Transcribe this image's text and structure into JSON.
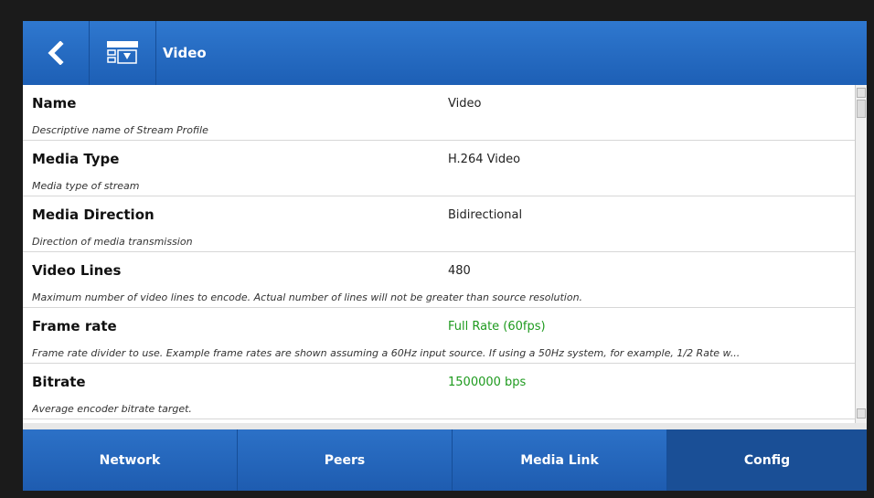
{
  "header": {
    "title": "Video",
    "back_icon": "chevron-left-icon",
    "profile_icon": "stream-profile-icon"
  },
  "rows": [
    {
      "label": "Name",
      "value": "Video",
      "desc": "Descriptive name of Stream Profile",
      "value_color": "default"
    },
    {
      "label": "Media Type",
      "value": "H.264 Video",
      "desc": "Media type of stream",
      "value_color": "default"
    },
    {
      "label": "Media Direction",
      "value": "Bidirectional",
      "desc": "Direction of media transmission",
      "value_color": "default"
    },
    {
      "label": "Video Lines",
      "value": "480",
      "desc": "Maximum number of video lines to encode. Actual number of lines will not be greater than source resolution.",
      "value_color": "default"
    },
    {
      "label": "Frame rate",
      "value": "Full Rate (60fps)",
      "desc": "Frame rate divider to use. Example frame rates are shown assuming a 60Hz input source. If using a 50Hz system, for example, 1/2 Rate w...",
      "value_color": "green"
    },
    {
      "label": "Bitrate",
      "value": "1500000 bps",
      "desc": "Average encoder bitrate target.",
      "value_color": "green"
    }
  ],
  "nav": {
    "items": [
      {
        "label": "Network"
      },
      {
        "label": "Peers"
      },
      {
        "label": "Media Link"
      },
      {
        "label": "Config"
      }
    ],
    "active": "Config"
  },
  "colors": {
    "header_blue": "#2f78cf",
    "value_green": "#1e9a1e",
    "nav_active": "#1a4f96"
  }
}
